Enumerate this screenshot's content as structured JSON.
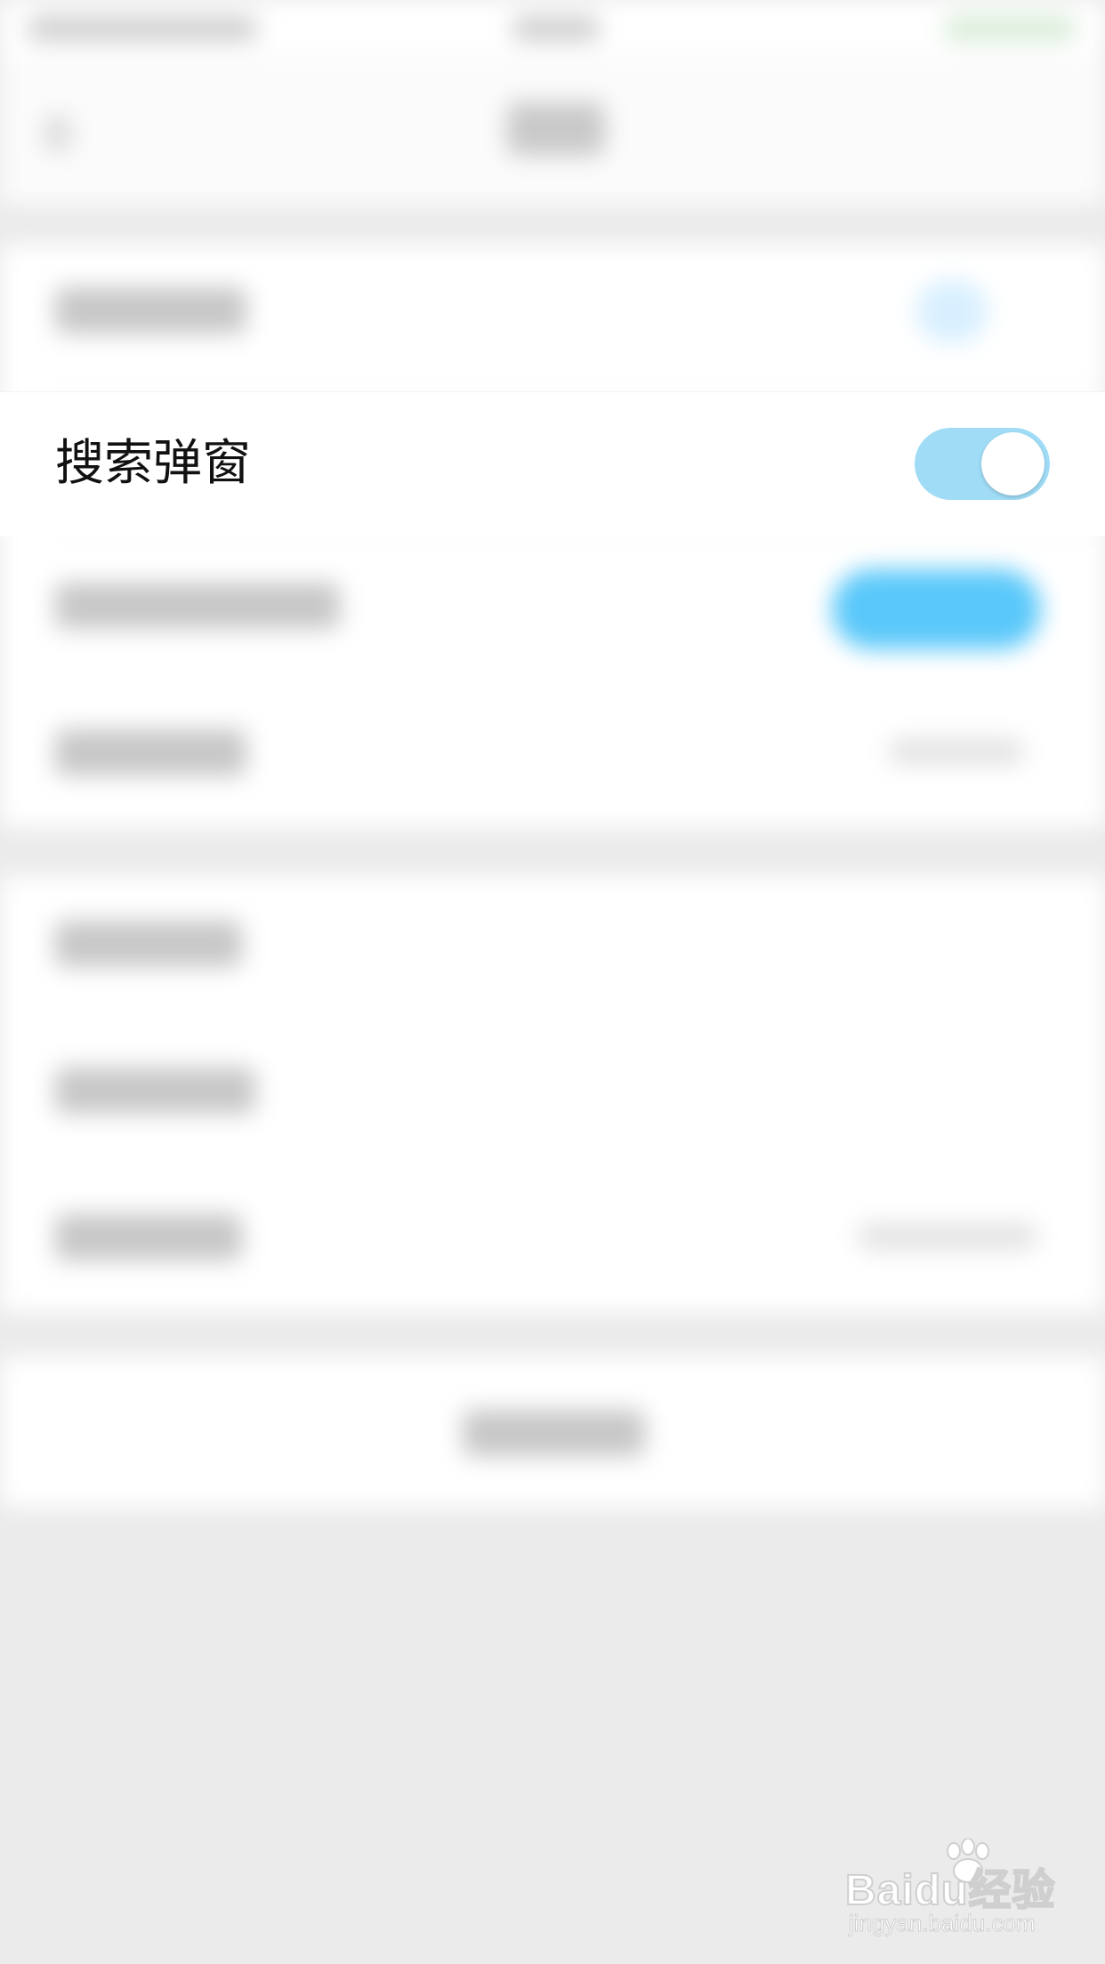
{
  "settings": {
    "search_popup": {
      "label": "搜索弹窗",
      "toggle_on": true
    }
  },
  "watermark": {
    "logo_text": "Baidu经验",
    "url": "jingyan.baidu.com"
  },
  "colors": {
    "toggle_track": "#a0dcf6",
    "accent": "#5ac8fa",
    "page_bg": "#ebebeb"
  }
}
